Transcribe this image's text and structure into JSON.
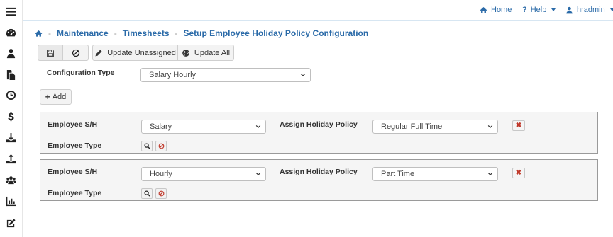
{
  "sidebar": {
    "items": [
      {
        "icon": "menu-icon"
      },
      {
        "icon": "dashboard-icon"
      },
      {
        "icon": "user-icon"
      },
      {
        "icon": "documents-icon"
      },
      {
        "icon": "clock-icon"
      },
      {
        "icon": "dollar-icon"
      },
      {
        "icon": "download-icon"
      },
      {
        "icon": "upload-icon"
      },
      {
        "icon": "users-icon"
      },
      {
        "icon": "bar-chart-icon"
      },
      {
        "icon": "edit-icon"
      }
    ]
  },
  "topbar": {
    "home": "Home",
    "help": "Help",
    "user": "hradmin"
  },
  "breadcrumb": {
    "items": [
      "Maintenance",
      "Timesheets",
      "Setup Employee Holiday Policy Configuration"
    ]
  },
  "toolbar": {
    "update_unassigned": "Update Unassigned",
    "update_all": "Update All"
  },
  "config": {
    "label": "Configuration Type",
    "value": "Salary Hourly"
  },
  "add_label": "Add",
  "rows": [
    {
      "employee_sh_label": "Employee S/H",
      "employee_sh_value": "Salary",
      "policy_label": "Assign Holiday Policy",
      "policy_value": "Regular Full Time",
      "employee_type_label": "Employee Type"
    },
    {
      "employee_sh_label": "Employee S/H",
      "employee_sh_value": "Hourly",
      "policy_label": "Assign Holiday Policy",
      "policy_value": "Part Time",
      "employee_type_label": "Employee Type"
    }
  ],
  "colors": {
    "link": "#2a6aa8",
    "danger": "#c0392b"
  }
}
